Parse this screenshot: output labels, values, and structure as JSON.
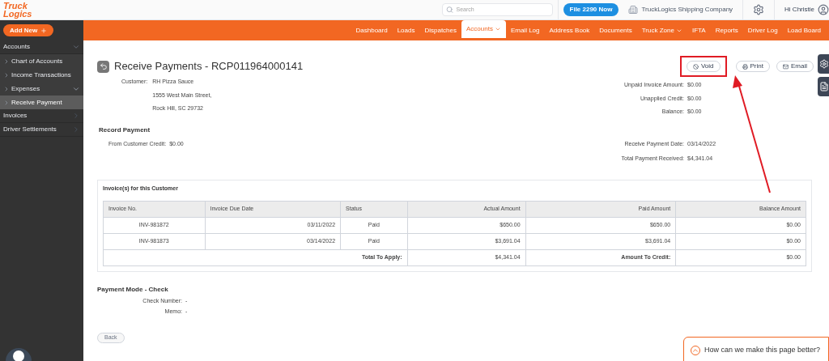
{
  "logo": {
    "line_1": "Truck",
    "line_2": "Logics"
  },
  "header": {
    "search": {
      "placeholder": "Search"
    },
    "promo_button": "File 2290 Now",
    "company": "TruckLogics Shipping Company",
    "greeting": "Hi Christie"
  },
  "sidebar": {
    "add_button": "Add New",
    "items": [
      {
        "label": "Accounts",
        "expanded": true,
        "selected": false,
        "children": [
          {
            "label": "Chart of Accounts",
            "selected": false,
            "has_submenu": false
          },
          {
            "label": "Income Transactions",
            "selected": false,
            "has_submenu": false
          },
          {
            "label": "Expenses",
            "selected": false,
            "has_submenu": true
          },
          {
            "label": "Receive Payment",
            "selected": true,
            "has_submenu": false
          }
        ]
      },
      {
        "label": "Invoices",
        "expanded": false,
        "selected": false
      },
      {
        "label": "Driver Settlements",
        "expanded": false,
        "selected": false
      }
    ]
  },
  "nav": [
    {
      "label": "Dashboard",
      "selected": false,
      "dropdown": false
    },
    {
      "label": "Loads",
      "selected": false,
      "dropdown": false
    },
    {
      "label": "Dispatches",
      "selected": false,
      "dropdown": false
    },
    {
      "label": "Accounts",
      "selected": true,
      "dropdown": true
    },
    {
      "label": "Email Log",
      "selected": false,
      "dropdown": false
    },
    {
      "label": "Address Book",
      "selected": false,
      "dropdown": false
    },
    {
      "label": "Documents",
      "selected": false,
      "dropdown": false
    },
    {
      "label": "Truck Zone",
      "selected": false,
      "dropdown": true
    },
    {
      "label": "IFTA",
      "selected": false,
      "dropdown": false
    },
    {
      "label": "Reports",
      "selected": false,
      "dropdown": false
    },
    {
      "label": "Driver Log",
      "selected": false,
      "dropdown": false
    },
    {
      "label": "Load Board",
      "selected": false,
      "dropdown": false
    }
  ],
  "page": {
    "title": "Receive Payments - RCP011964000141",
    "actions": [
      {
        "kind": "void",
        "label": "Void",
        "highlighted": true
      },
      {
        "kind": "print",
        "label": "Print",
        "highlighted": false
      },
      {
        "kind": "email",
        "label": "Email",
        "highlighted": false
      }
    ],
    "customer": {
      "label": "Customer:",
      "lines": [
        "RH Pizza Sauce",
        "1555 West Main Street,",
        "Rock Hill, SC 29732"
      ]
    },
    "summary": [
      {
        "label": "Unpaid Invoice Amount:",
        "value": "$0.00"
      },
      {
        "label": "Unapplied Credit:",
        "value": "$0.00"
      },
      {
        "label": "Balance:",
        "value": "$0.00"
      }
    ],
    "record_payment": {
      "title": "Record Payment",
      "left": [
        {
          "label": "From Customer Credit:",
          "value": "$0.00"
        }
      ],
      "right": [
        {
          "label": "Receive Payment Date:",
          "value": "03/14/2022"
        },
        {
          "label": "Total Payment Received:",
          "value": "$4,341.04"
        }
      ]
    },
    "invoices": {
      "title": "Invoice(s) for this Customer",
      "columns": [
        "Invoice No.",
        "Invoice Due Date",
        "Status",
        "Actual Amount",
        "Paid Amount",
        "Balance Amount"
      ],
      "rows": [
        [
          "INV-981872",
          "03/11/2022",
          "Paid",
          "$650.00",
          "$650.00",
          "$0.00"
        ],
        [
          "INV-981873",
          "03/14/2022",
          "Paid",
          "$3,691.04",
          "$3,691.04",
          "$0.00"
        ]
      ],
      "totals": {
        "apply_label": "Total To Apply:",
        "apply_value": "$4,341.04",
        "credit_label": "Amount To Credit:",
        "credit_value": "$0.00"
      }
    },
    "payment_mode": {
      "title": "Payment Mode - Check",
      "fields": [
        {
          "label": "Check Number:",
          "value": "-"
        },
        {
          "label": "Memo:",
          "value": "-"
        }
      ]
    },
    "back_button": "Back"
  },
  "feedback": {
    "label": "How can we make this page better?"
  }
}
